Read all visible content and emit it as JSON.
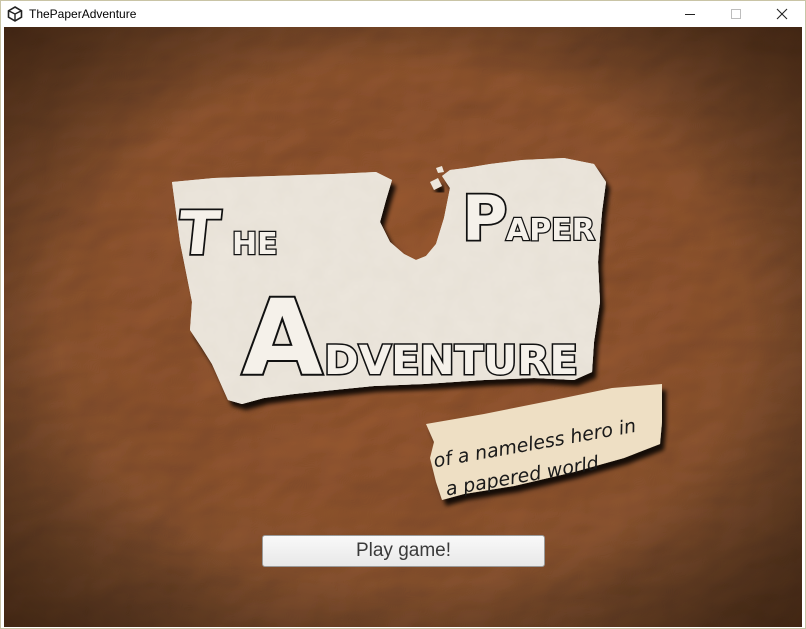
{
  "window": {
    "title": "ThePaperAdventure",
    "icon": "unity-icon",
    "controls": [
      "minimize-icon",
      "maximize-icon",
      "close-icon"
    ]
  },
  "logo": {
    "line1_word1": "The",
    "line1_word2": "Paper",
    "line2": "Adventure",
    "tagline_line1": "of a nameless hero in",
    "tagline_line2": "a papered world"
  },
  "menu": {
    "play_label": "Play game!"
  },
  "colors": {
    "background_brown": "#8a4f27",
    "paper_white": "#efe9df",
    "tagline_paper": "#eedfc4",
    "ink": "#1a1a1a",
    "button_text": "#3a3a3a"
  }
}
